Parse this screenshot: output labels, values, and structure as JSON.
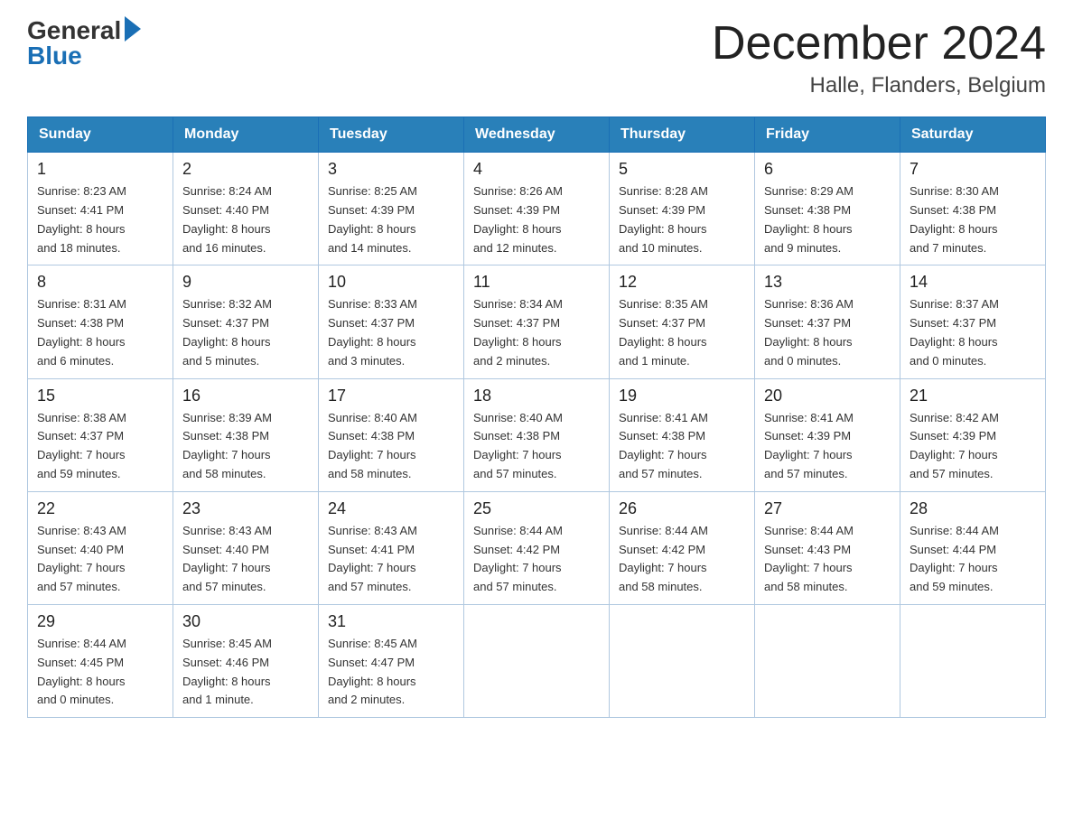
{
  "header": {
    "logo_general": "General",
    "logo_blue": "Blue",
    "month_year": "December 2024",
    "location": "Halle, Flanders, Belgium"
  },
  "days_of_week": [
    "Sunday",
    "Monday",
    "Tuesday",
    "Wednesday",
    "Thursday",
    "Friday",
    "Saturday"
  ],
  "weeks": [
    [
      {
        "day": "1",
        "sunrise": "8:23 AM",
        "sunset": "4:41 PM",
        "daylight": "8 hours and 18 minutes."
      },
      {
        "day": "2",
        "sunrise": "8:24 AM",
        "sunset": "4:40 PM",
        "daylight": "8 hours and 16 minutes."
      },
      {
        "day": "3",
        "sunrise": "8:25 AM",
        "sunset": "4:39 PM",
        "daylight": "8 hours and 14 minutes."
      },
      {
        "day": "4",
        "sunrise": "8:26 AM",
        "sunset": "4:39 PM",
        "daylight": "8 hours and 12 minutes."
      },
      {
        "day": "5",
        "sunrise": "8:28 AM",
        "sunset": "4:39 PM",
        "daylight": "8 hours and 10 minutes."
      },
      {
        "day": "6",
        "sunrise": "8:29 AM",
        "sunset": "4:38 PM",
        "daylight": "8 hours and 9 minutes."
      },
      {
        "day": "7",
        "sunrise": "8:30 AM",
        "sunset": "4:38 PM",
        "daylight": "8 hours and 7 minutes."
      }
    ],
    [
      {
        "day": "8",
        "sunrise": "8:31 AM",
        "sunset": "4:38 PM",
        "daylight": "8 hours and 6 minutes."
      },
      {
        "day": "9",
        "sunrise": "8:32 AM",
        "sunset": "4:37 PM",
        "daylight": "8 hours and 5 minutes."
      },
      {
        "day": "10",
        "sunrise": "8:33 AM",
        "sunset": "4:37 PM",
        "daylight": "8 hours and 3 minutes."
      },
      {
        "day": "11",
        "sunrise": "8:34 AM",
        "sunset": "4:37 PM",
        "daylight": "8 hours and 2 minutes."
      },
      {
        "day": "12",
        "sunrise": "8:35 AM",
        "sunset": "4:37 PM",
        "daylight": "8 hours and 1 minute."
      },
      {
        "day": "13",
        "sunrise": "8:36 AM",
        "sunset": "4:37 PM",
        "daylight": "8 hours and 0 minutes."
      },
      {
        "day": "14",
        "sunrise": "8:37 AM",
        "sunset": "4:37 PM",
        "daylight": "8 hours and 0 minutes."
      }
    ],
    [
      {
        "day": "15",
        "sunrise": "8:38 AM",
        "sunset": "4:37 PM",
        "daylight": "7 hours and 59 minutes."
      },
      {
        "day": "16",
        "sunrise": "8:39 AM",
        "sunset": "4:38 PM",
        "daylight": "7 hours and 58 minutes."
      },
      {
        "day": "17",
        "sunrise": "8:40 AM",
        "sunset": "4:38 PM",
        "daylight": "7 hours and 58 minutes."
      },
      {
        "day": "18",
        "sunrise": "8:40 AM",
        "sunset": "4:38 PM",
        "daylight": "7 hours and 57 minutes."
      },
      {
        "day": "19",
        "sunrise": "8:41 AM",
        "sunset": "4:38 PM",
        "daylight": "7 hours and 57 minutes."
      },
      {
        "day": "20",
        "sunrise": "8:41 AM",
        "sunset": "4:39 PM",
        "daylight": "7 hours and 57 minutes."
      },
      {
        "day": "21",
        "sunrise": "8:42 AM",
        "sunset": "4:39 PM",
        "daylight": "7 hours and 57 minutes."
      }
    ],
    [
      {
        "day": "22",
        "sunrise": "8:43 AM",
        "sunset": "4:40 PM",
        "daylight": "7 hours and 57 minutes."
      },
      {
        "day": "23",
        "sunrise": "8:43 AM",
        "sunset": "4:40 PM",
        "daylight": "7 hours and 57 minutes."
      },
      {
        "day": "24",
        "sunrise": "8:43 AM",
        "sunset": "4:41 PM",
        "daylight": "7 hours and 57 minutes."
      },
      {
        "day": "25",
        "sunrise": "8:44 AM",
        "sunset": "4:42 PM",
        "daylight": "7 hours and 57 minutes."
      },
      {
        "day": "26",
        "sunrise": "8:44 AM",
        "sunset": "4:42 PM",
        "daylight": "7 hours and 58 minutes."
      },
      {
        "day": "27",
        "sunrise": "8:44 AM",
        "sunset": "4:43 PM",
        "daylight": "7 hours and 58 minutes."
      },
      {
        "day": "28",
        "sunrise": "8:44 AM",
        "sunset": "4:44 PM",
        "daylight": "7 hours and 59 minutes."
      }
    ],
    [
      {
        "day": "29",
        "sunrise": "8:44 AM",
        "sunset": "4:45 PM",
        "daylight": "8 hours and 0 minutes."
      },
      {
        "day": "30",
        "sunrise": "8:45 AM",
        "sunset": "4:46 PM",
        "daylight": "8 hours and 1 minute."
      },
      {
        "day": "31",
        "sunrise": "8:45 AM",
        "sunset": "4:47 PM",
        "daylight": "8 hours and 2 minutes."
      },
      null,
      null,
      null,
      null
    ]
  ]
}
